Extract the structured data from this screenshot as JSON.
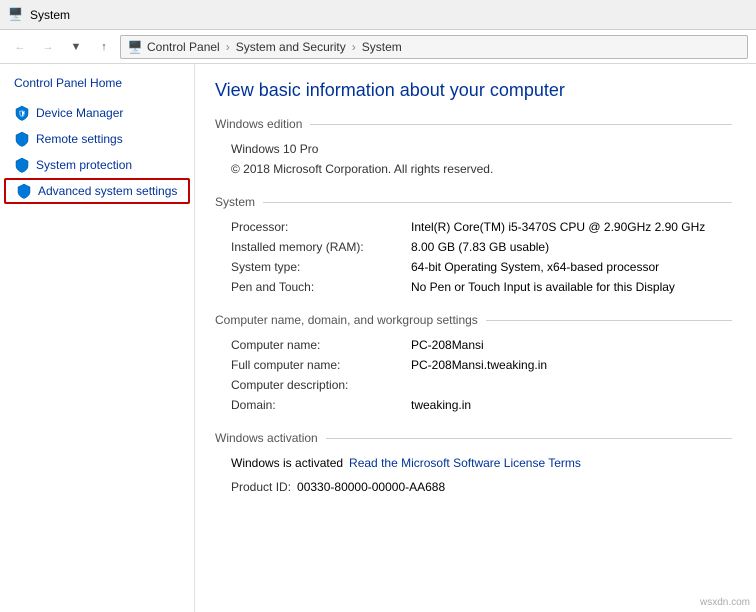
{
  "titlebar": {
    "title": "System",
    "icon": "💻"
  },
  "addressbar": {
    "breadcrumbs": [
      "Control Panel",
      "System and Security",
      "System"
    ],
    "separator": "›"
  },
  "sidebar": {
    "home_label": "Control Panel Home",
    "items": [
      {
        "id": "device-manager",
        "label": "Device Manager",
        "active": false
      },
      {
        "id": "remote-settings",
        "label": "Remote settings",
        "active": false
      },
      {
        "id": "system-protection",
        "label": "System protection",
        "active": false
      },
      {
        "id": "advanced-system-settings",
        "label": "Advanced system settings",
        "active": true
      }
    ]
  },
  "content": {
    "page_title": "View basic information about your computer",
    "sections": {
      "windows_edition": {
        "header": "Windows edition",
        "edition": "Windows 10 Pro",
        "copyright": "© 2018 Microsoft Corporation. All rights reserved."
      },
      "system": {
        "header": "System",
        "rows": [
          {
            "label": "Processor:",
            "value": "Intel(R) Core(TM) i5-3470S CPU @ 2.90GHz   2.90 GHz"
          },
          {
            "label": "Installed memory (RAM):",
            "value": "8.00 GB (7.83 GB usable)"
          },
          {
            "label": "System type:",
            "value": "64-bit Operating System, x64-based processor"
          },
          {
            "label": "Pen and Touch:",
            "value": "No Pen or Touch Input is available for this Display"
          }
        ]
      },
      "computer_name": {
        "header": "Computer name, domain, and workgroup settings",
        "rows": [
          {
            "label": "Computer name:",
            "value": "PC-208Mansi"
          },
          {
            "label": "Full computer name:",
            "value": "PC-208Mansi.tweaking.in"
          },
          {
            "label": "Computer description:",
            "value": ""
          },
          {
            "label": "Domain:",
            "value": "tweaking.in"
          }
        ]
      },
      "windows_activation": {
        "header": "Windows activation",
        "activation_text": "Windows is activated",
        "activation_link": "Read the Microsoft Software License Terms",
        "product_id_label": "Product ID:",
        "product_id_value": "00330-80000-00000-AA688"
      }
    }
  },
  "watermark": "wsxdn.com"
}
